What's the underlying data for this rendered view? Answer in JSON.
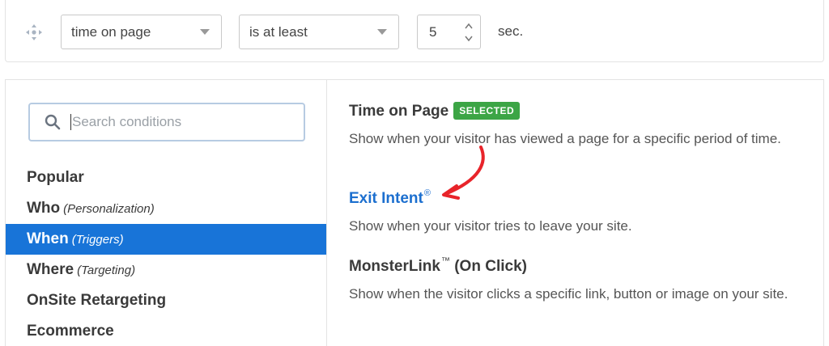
{
  "rule": {
    "metric_select": {
      "value": "time on page"
    },
    "operator_select": {
      "value": "is at least"
    },
    "amount": {
      "value": "5"
    },
    "unit": "sec."
  },
  "search": {
    "placeholder": "Search conditions"
  },
  "sidebar": {
    "items": [
      {
        "label": "Popular",
        "sub": "",
        "active": false
      },
      {
        "label": "Who",
        "sub": "(Personalization)",
        "active": false
      },
      {
        "label": "When",
        "sub": "(Triggers)",
        "active": true
      },
      {
        "label": "Where",
        "sub": "(Targeting)",
        "active": false
      },
      {
        "label": "OnSite Retargeting",
        "sub": "",
        "active": false
      },
      {
        "label": "Ecommerce",
        "sub": "",
        "active": false
      }
    ]
  },
  "conditions": [
    {
      "title": "Time on Page",
      "badge": "SELECTED",
      "description": "Show when your visitor has viewed a page for a specific period of time."
    },
    {
      "title": "Exit Intent",
      "title_mark": "®",
      "description": "Show when your visitor tries to leave your site."
    },
    {
      "title": "MonsterLink",
      "title_mark": "™",
      "title_suffix": " (On Click)",
      "description": "Show when the visitor clicks a specific link, button or image on your site."
    }
  ],
  "colors": {
    "active_nav": "#1874d8",
    "link": "#1c6fcf",
    "badge": "#3ca545",
    "annotation_arrow": "#e8242a"
  },
  "icons": [
    "drag-handle-icon",
    "chevron-down-icon",
    "spinner-icon",
    "search-icon",
    "annotation-arrow"
  ]
}
